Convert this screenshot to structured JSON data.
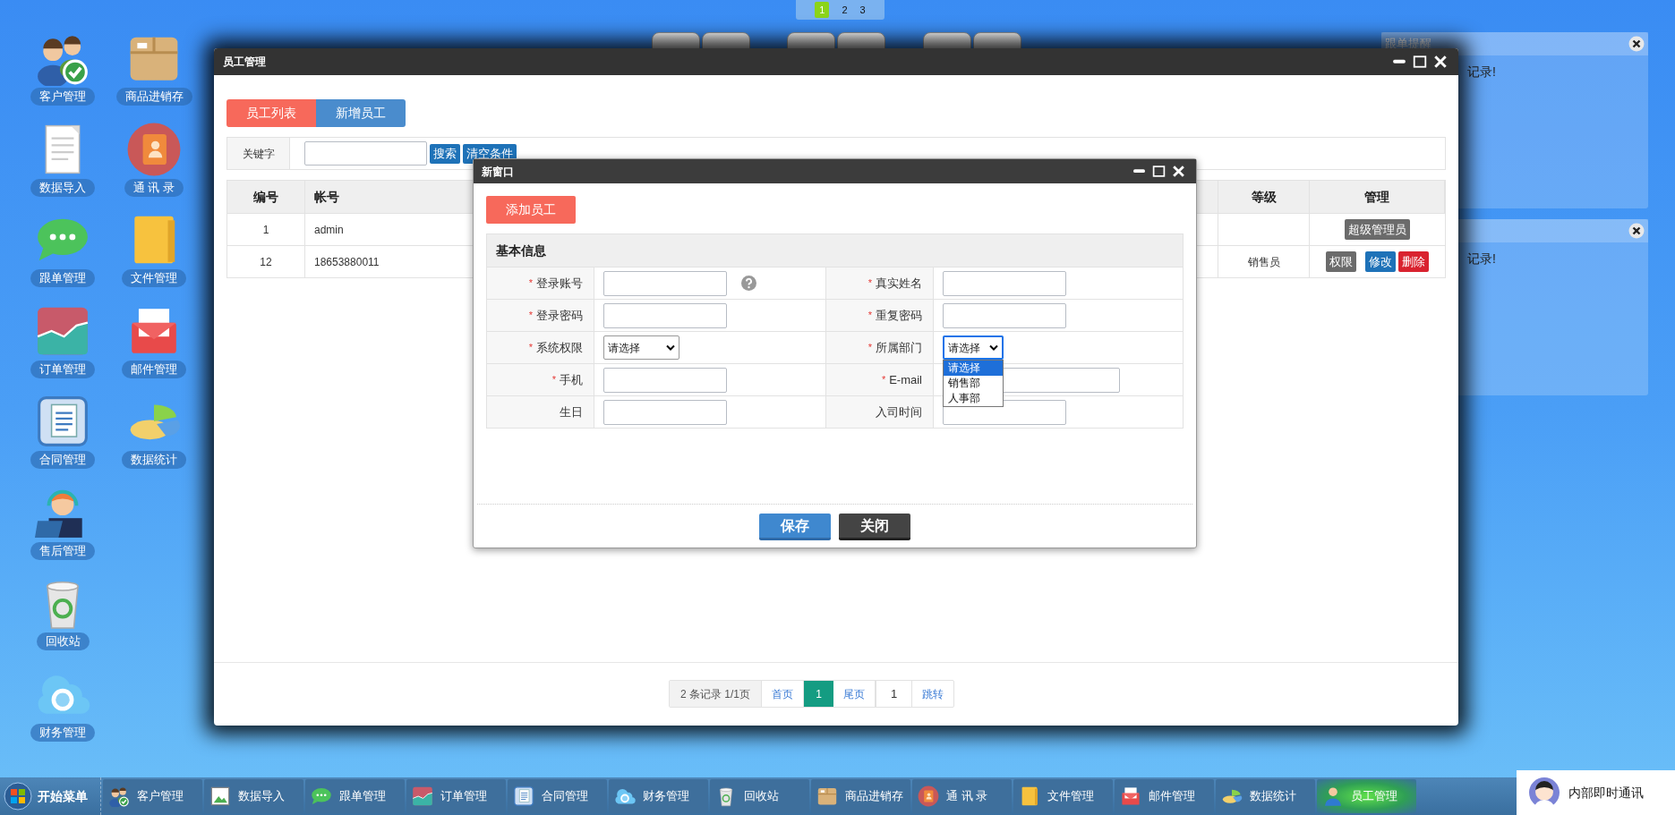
{
  "workspace_switcher": [
    {
      "label": "1",
      "selected": true
    },
    {
      "label": "2",
      "selected": false
    },
    {
      "label": "3",
      "selected": false
    }
  ],
  "desktop_icons": [
    {
      "label": "客户管理"
    },
    {
      "label": "数据导入"
    },
    {
      "label": "跟单管理"
    },
    {
      "label": "订单管理"
    },
    {
      "label": "合同管理"
    },
    {
      "label": "售后管理"
    },
    {
      "label": "回收站"
    },
    {
      "label": "财务管理"
    },
    {
      "label": "商品进销存"
    },
    {
      "label": "通 讯 录"
    },
    {
      "label": "文件管理"
    },
    {
      "label": "邮件管理"
    },
    {
      "label": "数据统计"
    }
  ],
  "notifications": [
    {
      "title": "跟单提醒",
      "message": "记录!"
    },
    {
      "message": "记录!"
    }
  ],
  "main_window": {
    "title": "员工管理",
    "tabs": [
      {
        "label": "员工列表",
        "selected": true
      },
      {
        "label": "新增员工",
        "selected": false
      }
    ],
    "search": {
      "label": "关键字",
      "buttons": [
        "搜索",
        "清空条件"
      ]
    },
    "table": {
      "columns": [
        "编号",
        "帐号",
        "等级",
        "管理"
      ],
      "rows": [
        {
          "id": "1",
          "account": "admin",
          "actions": [
            {
              "label": "超级管理员",
              "kind": "neutral"
            }
          ]
        },
        {
          "id": "12",
          "account": "18653880011",
          "level": "销售员",
          "actions": [
            {
              "label": "权限",
              "kind": "neutral"
            },
            {
              "label": "修改",
              "kind": "primary"
            },
            {
              "label": "删除",
              "kind": "danger"
            }
          ]
        }
      ]
    },
    "pagination": [
      {
        "kind": "info",
        "label": "2 条记录 1/1页"
      },
      {
        "kind": "link",
        "label": "首页"
      },
      {
        "kind": "page",
        "label": "1",
        "selected": true
      },
      {
        "kind": "link",
        "label": "尾页"
      },
      {
        "kind": "input",
        "value": "1"
      },
      {
        "kind": "link",
        "label": "跳转"
      }
    ]
  },
  "dialog": {
    "title": "新窗口",
    "add_button": "添加员工",
    "section": "基本信息",
    "fields": [
      {
        "label": "登录账号",
        "mark": "*",
        "kind": "input",
        "help": true
      },
      {
        "label": "真实姓名",
        "mark": "*",
        "kind": "input"
      },
      {
        "label": "登录密码",
        "mark": "*",
        "kind": "input"
      },
      {
        "label": "重复密码",
        "mark": "*",
        "kind": "input"
      },
      {
        "label": "系统权限",
        "mark": "*",
        "kind": "select",
        "value": "请选择",
        "open": false
      },
      {
        "label": "所属部门",
        "mark": "*",
        "kind": "select",
        "value": "请选择",
        "open": true,
        "options": [
          {
            "label": "请选择",
            "selected": true
          },
          {
            "label": "销售部",
            "selected": false
          },
          {
            "label": "人事部",
            "selected": false
          }
        ]
      },
      {
        "label": "手机",
        "mark": "*",
        "kind": "input"
      },
      {
        "label": "E-mail",
        "mark": "*",
        "kind": "email"
      },
      {
        "label": "生日",
        "kind": "input"
      },
      {
        "label": "入司时间",
        "kind": "input"
      }
    ],
    "buttons": [
      {
        "label": "保存",
        "kind": "primary"
      },
      {
        "label": "关闭",
        "kind": "dark"
      }
    ]
  },
  "taskbar": {
    "start": "开始菜单",
    "items": [
      {
        "label": "客户管理",
        "active": false
      },
      {
        "label": "数据导入",
        "active": false
      },
      {
        "label": "跟单管理",
        "active": false
      },
      {
        "label": "订单管理",
        "active": false
      },
      {
        "label": "合同管理",
        "active": false
      },
      {
        "label": "财务管理",
        "active": false
      },
      {
        "label": "回收站",
        "active": false
      },
      {
        "label": "商品进销存",
        "active": false
      },
      {
        "label": "通 讯 录",
        "active": false
      },
      {
        "label": "文件管理",
        "active": false
      },
      {
        "label": "邮件管理",
        "active": false
      },
      {
        "label": "数据统计",
        "active": false
      },
      {
        "label": "员工管理",
        "active": true
      }
    ],
    "chat": "内部即时通讯"
  }
}
